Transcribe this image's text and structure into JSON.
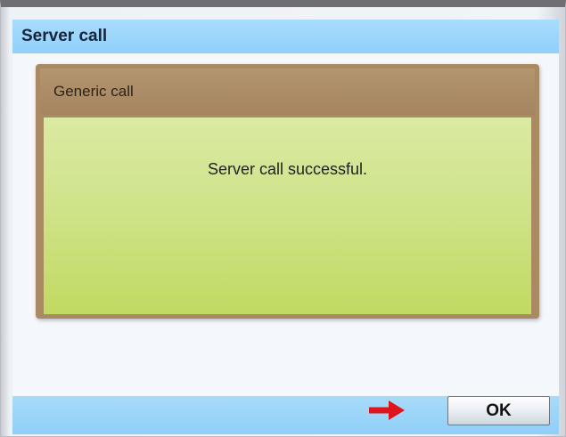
{
  "window": {
    "title": "Server call"
  },
  "panel": {
    "header": "Generic call",
    "message": "Server call successful."
  },
  "footer": {
    "ok_label": "OK",
    "arrow_icon": "arrow-right-icon",
    "arrow_color": "#e0141b"
  }
}
